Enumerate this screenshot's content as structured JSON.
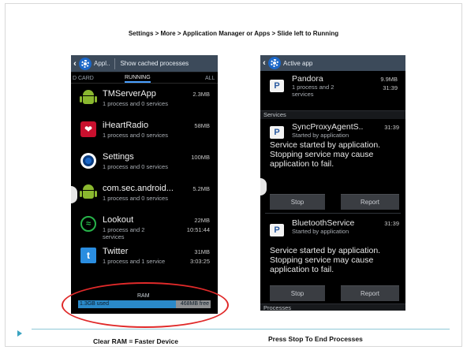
{
  "slide": {
    "title": "Settings > More > Application Manager or Apps > Slide left to Running",
    "caption_left": "Clear RAM = Faster Device",
    "caption_right": "Press Stop To End Processes"
  },
  "left_phone": {
    "actionbar": {
      "title": "Appl..",
      "button": "Show cached processes"
    },
    "tabs": {
      "left": "D CARD",
      "active": "RUNNING",
      "right": "ALL"
    },
    "apps": [
      {
        "name": "TMServerApp",
        "sub": "1 process and 0 services",
        "size": "2.3MB",
        "time": "",
        "icon": "android-icon"
      },
      {
        "name": "iHeartRadio",
        "sub": "1 process and 0 services",
        "size": "58MB",
        "time": "",
        "icon": "iheartradio-icon"
      },
      {
        "name": "Settings",
        "sub": "1 process and 0 services",
        "size": "100MB",
        "time": "",
        "icon": "settings-gear-icon"
      },
      {
        "name": "com.sec.android...",
        "sub": "1 process and 0 services",
        "size": "5.2MB",
        "time": "",
        "icon": "android-icon"
      },
      {
        "name": "Lookout",
        "sub": "1 process and 2 services",
        "size": "22MB",
        "time": "10:51:44",
        "icon": "lookout-icon"
      },
      {
        "name": "Twitter",
        "sub": "1 process and 1 service",
        "size": "31MB",
        "time": "3:03:25",
        "icon": "twitter-icon"
      }
    ],
    "ram": {
      "title": "RAM",
      "used": "1.3GB used",
      "free": "468MB free",
      "used_fraction": 0.74
    }
  },
  "right_phone": {
    "actionbar": {
      "title": "Active app"
    },
    "top_app": {
      "name": "Pandora",
      "sub": "1 process and 2 services",
      "size": "9.9MB",
      "time": "31:39"
    },
    "services_header": "Services",
    "services": [
      {
        "name": "SyncProxyAgentS..",
        "sub": "Started by application",
        "time": "31:39",
        "message": "Service started by application. Stopping service may cause application to fail.",
        "stop_label": "Stop",
        "report_label": "Report"
      },
      {
        "name": "BluetoothService",
        "sub": "Started by application",
        "time": "31:39",
        "message": "Service started by application. Stopping service may cause application to fail.",
        "stop_label": "Stop",
        "report_label": "Report"
      }
    ],
    "processes_header": "Processes"
  },
  "colors": {
    "accent_blue": "#1b67c8",
    "highlight_red": "#e02a2a",
    "rule": "#8fc9d7"
  }
}
